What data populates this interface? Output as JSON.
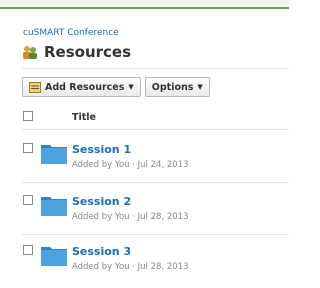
{
  "site": {
    "name": "cuSMART Conference"
  },
  "page": {
    "title": "Resources"
  },
  "toolbar": {
    "add_label": "Add Resources",
    "options_label": "Options",
    "caret": "▼"
  },
  "table": {
    "column_title": "Title",
    "rows": [
      {
        "title": "Session 1",
        "meta": "Added by You · Jul 24, 2013"
      },
      {
        "title": "Session 2",
        "meta": "Added by You · Jul 28, 2013"
      },
      {
        "title": "Session 3",
        "meta": "Added by You · Jul 28, 2013"
      }
    ]
  },
  "colors": {
    "link": "#1a6eb5",
    "folder": "#3f9ad8",
    "accent_bar": "#6aa84f"
  },
  "icons": {
    "title": "resources-people-icon",
    "add": "add-resources-icon",
    "row": "folder-icon"
  }
}
